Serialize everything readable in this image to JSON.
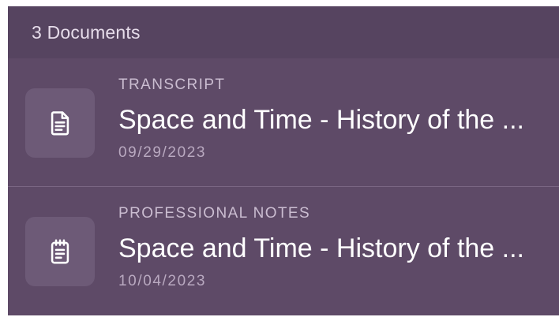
{
  "header": {
    "title": "3 Documents"
  },
  "documents": [
    {
      "type": "TRANSCRIPT",
      "title": "Space and Time - History of the ...",
      "date": "09/29/2023",
      "icon": "document-icon"
    },
    {
      "type": "PROFESSIONAL NOTES",
      "title": "Space and Time - History of the ...",
      "date": "10/04/2023",
      "icon": "notepad-icon"
    }
  ]
}
